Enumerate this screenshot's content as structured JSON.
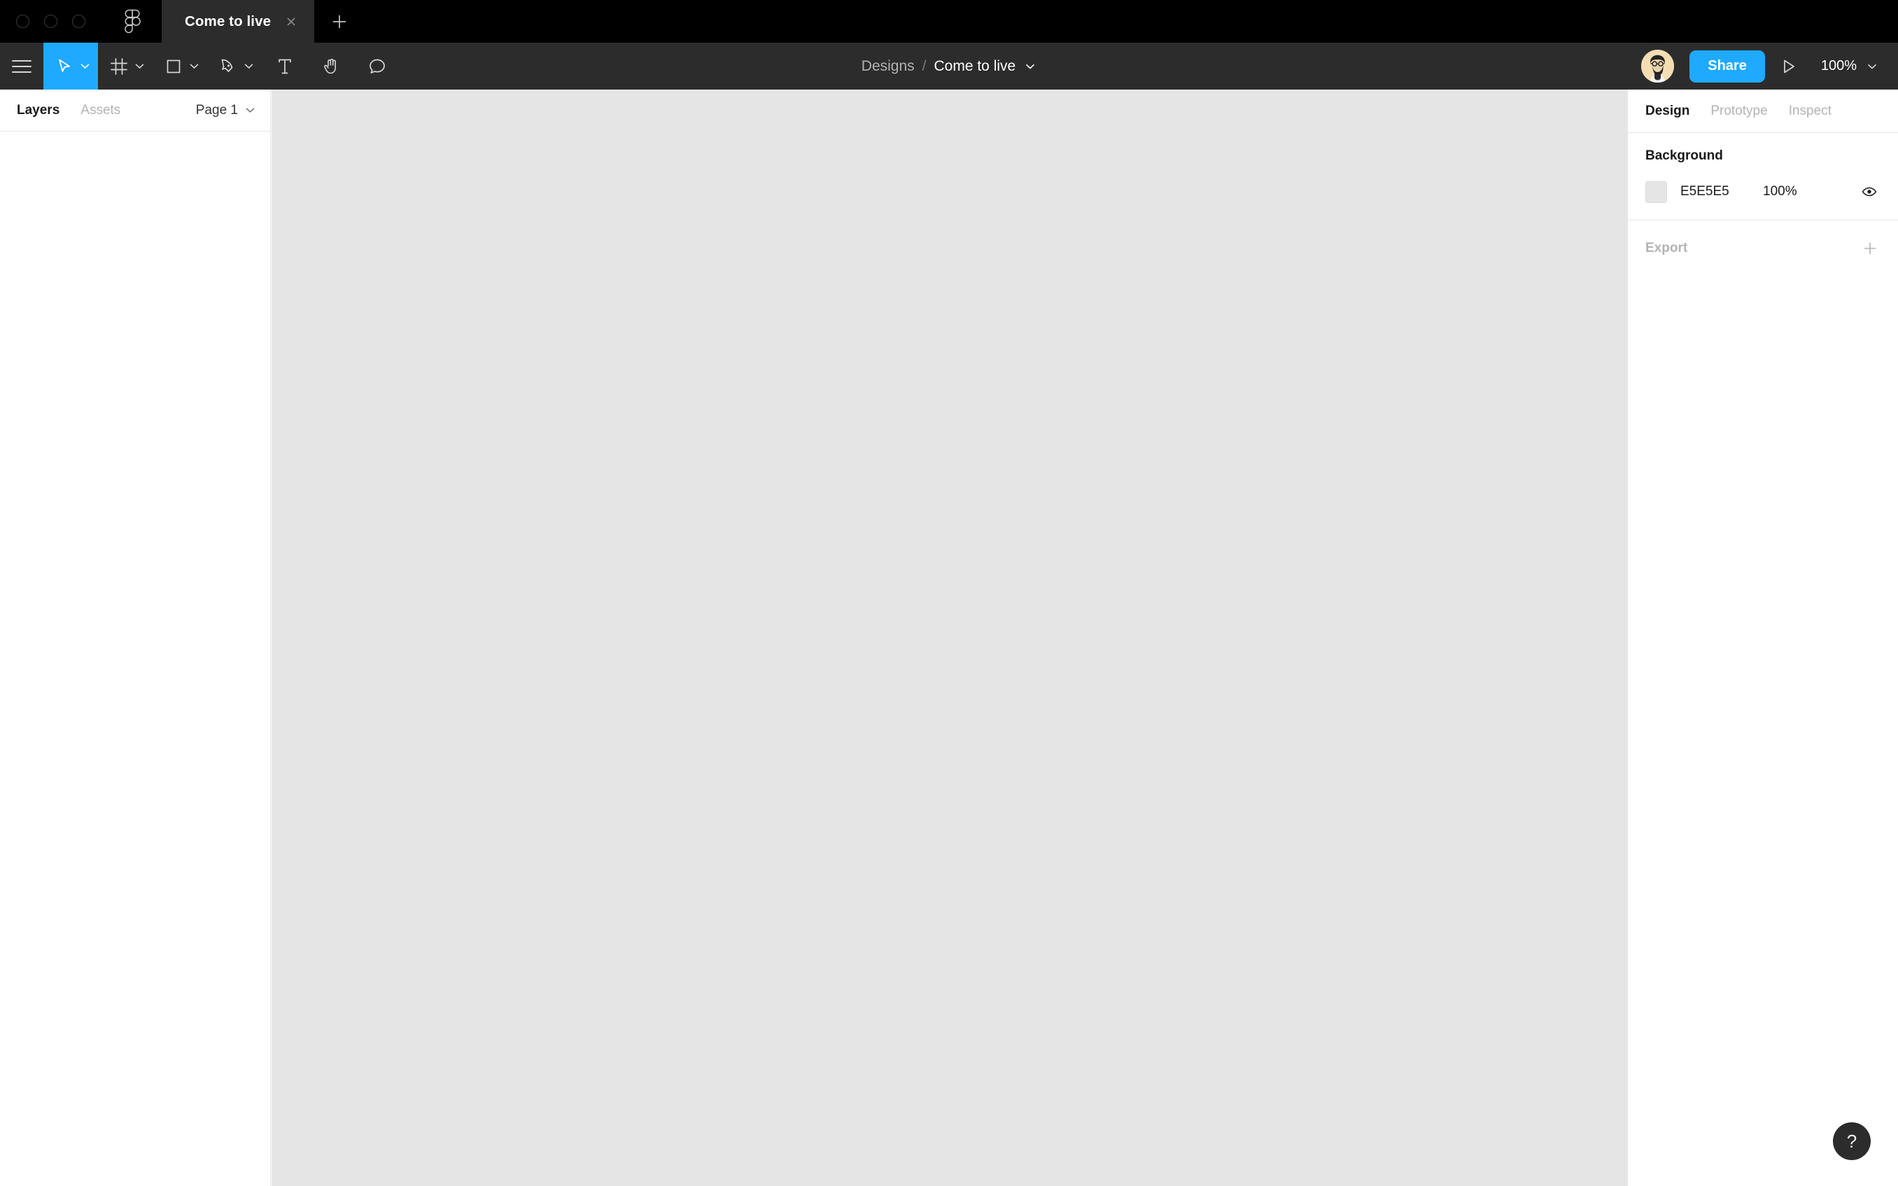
{
  "window": {
    "traffic_lights": [
      "close",
      "minimize",
      "zoom"
    ],
    "app_logo": "figma-logo-icon"
  },
  "tabs": {
    "items": [
      {
        "label": "Come to live",
        "active": true,
        "close_icon": "close-icon"
      }
    ],
    "new_tab_icon": "plus-icon"
  },
  "toolbar": {
    "menu_icon": "hamburger-menu-icon",
    "tools": [
      {
        "name": "move-tool",
        "icon": "cursor-arrow-icon",
        "active": true,
        "has_caret": true
      },
      {
        "name": "frame-tool",
        "icon": "frame-icon",
        "active": false,
        "has_caret": true
      },
      {
        "name": "shape-tool",
        "icon": "square-icon",
        "active": false,
        "has_caret": true
      },
      {
        "name": "pen-tool",
        "icon": "pen-icon",
        "active": false,
        "has_caret": true
      },
      {
        "name": "text-tool",
        "icon": "text-t-icon",
        "active": false,
        "has_caret": false
      },
      {
        "name": "hand-tool",
        "icon": "hand-icon",
        "active": false,
        "has_caret": false
      },
      {
        "name": "comment-tool",
        "icon": "comment-bubble-icon",
        "active": false,
        "has_caret": false
      }
    ],
    "breadcrumb": {
      "root": "Designs",
      "separator": "/",
      "document": "Come to live",
      "caret_icon": "chevron-down-icon"
    },
    "avatar": {
      "name": "user-avatar",
      "bg_color": "#F5DDB3"
    },
    "share_label": "Share",
    "present_icon": "play-triangle-icon",
    "zoom_label": "100%",
    "zoom_caret_icon": "chevron-down-icon"
  },
  "left_panel": {
    "tabs": [
      {
        "label": "Layers",
        "active": true
      },
      {
        "label": "Assets",
        "active": false
      }
    ],
    "page_selector": {
      "label": "Page 1",
      "caret_icon": "chevron-down-icon"
    },
    "layers": []
  },
  "canvas": {
    "background_color": "#E5E5E5"
  },
  "right_panel": {
    "tabs": [
      {
        "label": "Design",
        "active": true
      },
      {
        "label": "Prototype",
        "active": false
      },
      {
        "label": "Inspect",
        "active": false
      }
    ],
    "background_section": {
      "title": "Background",
      "swatch_color": "#E5E5E5",
      "hex": "E5E5E5",
      "opacity": "100%",
      "visibility_icon": "eye-icon"
    },
    "export_section": {
      "title": "Export",
      "add_icon": "plus-icon"
    }
  },
  "help": {
    "label": "?"
  },
  "colors": {
    "accent": "#1EAAFF",
    "titlebar": "#000000",
    "toolbar": "#2C2C2C",
    "canvas": "#E5E5E5",
    "panel": "#FFFFFF",
    "divider": "#E5E5E5"
  }
}
